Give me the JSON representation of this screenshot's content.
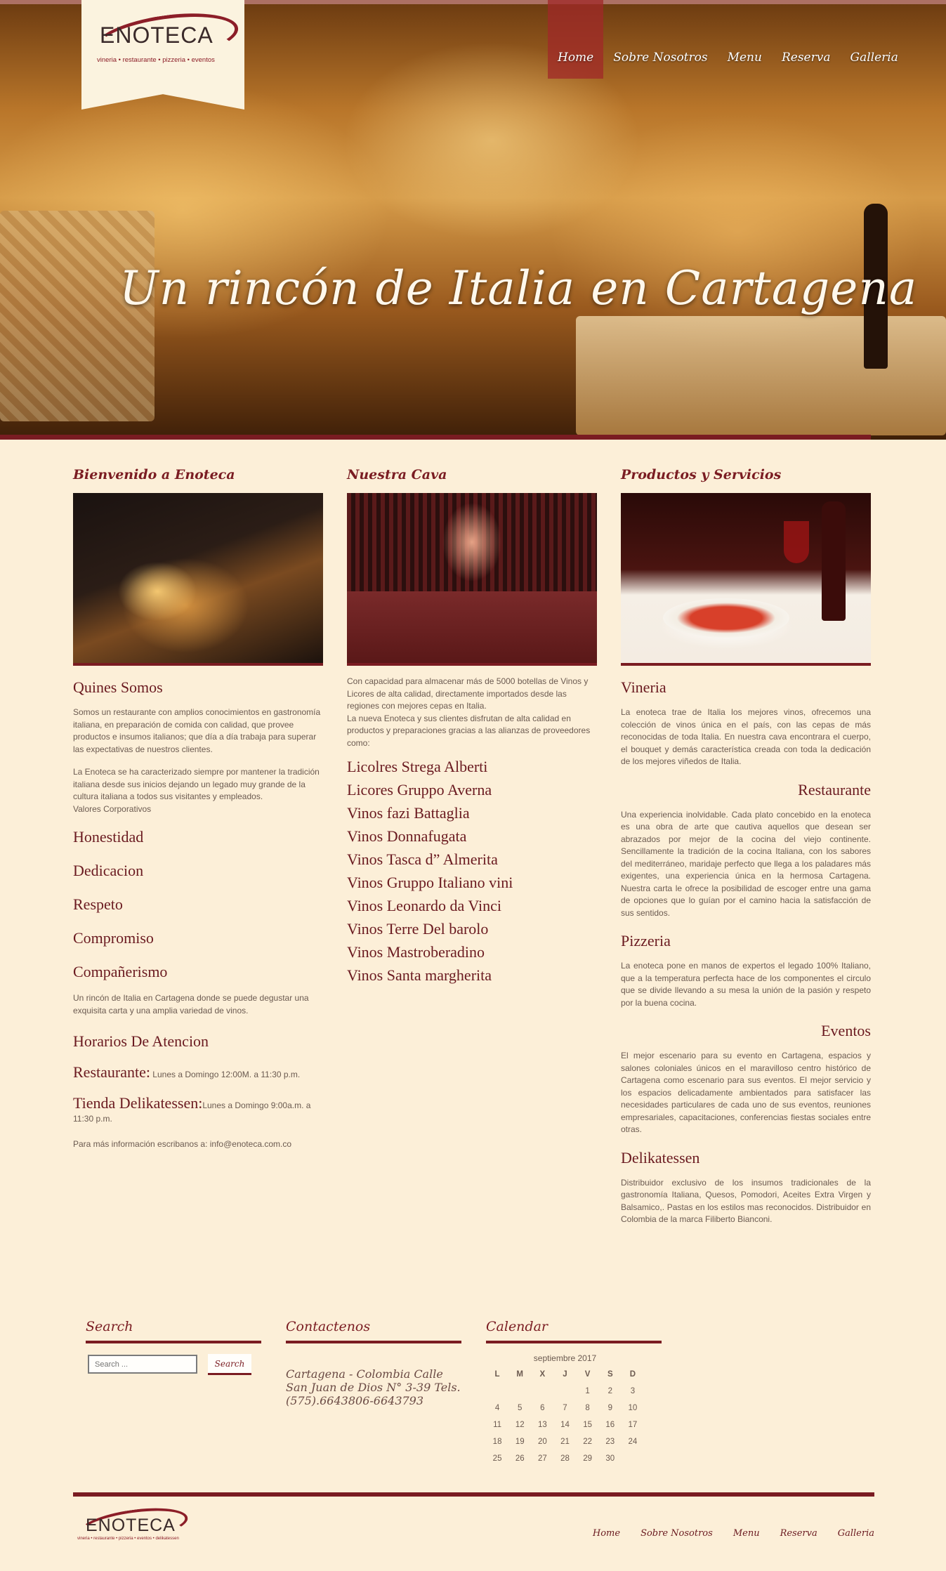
{
  "header": {
    "logo": {
      "name": "ENOTECA",
      "subtitle": "vineria • restaurante • pizzeria • eventos"
    },
    "nav": [
      {
        "label": "Home",
        "active": true
      },
      {
        "label": "Sobre Nosotros"
      },
      {
        "label": "Menu"
      },
      {
        "label": "Reserva"
      },
      {
        "label": "Galleria"
      }
    ],
    "tagline": "Un rincón de Italia en  Cartagena"
  },
  "col1": {
    "title": "Bienvenido a Enoteca",
    "heading": "Quines Somos",
    "para1": "Somos un restaurante con amplios conocimientos en gastronomía italiana, en preparación de comida con calidad, que provee productos e insumos italianos; que día a día trabaja para superar las expectativas de nuestros clientes.",
    "para2": "La Enoteca se ha caracterizado siempre por mantener la tradición italiana desde sus inicios dejando un legado muy grande de la cultura italiana a todos sus visitantes y empleados.",
    "values_label": "Valores Corporativos",
    "values": [
      "Honestidad",
      "Dedicacion",
      "Respeto",
      "Compromiso",
      "Compañerismo"
    ],
    "para3": "Un rincón de Italia en Cartagena donde se puede degustar una exquisita carta y una amplia variedad de vinos.",
    "hours_heading": "Horarios De Atencion",
    "hours": [
      {
        "label": "Restaurante:",
        "text": " Lunes a Domingo 12:00M. a 11:30 p.m."
      },
      {
        "label": "Tienda Delikatessen:",
        "text": "Lunes a Domingo 9:00a.m. a 11:30 p.m."
      }
    ],
    "contact_text": "Para más información escribanos a: info@enoteca.com.co"
  },
  "col2": {
    "title": "Nuestra Cava",
    "para": "Con capacidad para almacenar más de 5000 botellas de Vinos y Licores de alta calidad, directamente importados desde las regiones con mejores cepas en Italia.\nLa nueva Enoteca y sus clientes disfrutan de alta calidad en productos y preparaciones gracias a las alianzas de proveedores como:",
    "wines": [
      "Licolres Strega Alberti",
      "Licores Gruppo Averna",
      "Vinos fazi Battaglia",
      "Vinos Donnafugata",
      "Vinos Tasca d” Almerita",
      "Vinos Gruppo Italiano vini",
      "Vinos Leonardo da Vinci",
      "Vinos Terre Del barolo",
      "Vinos Mastroberadino",
      "Vinos Santa margherita"
    ]
  },
  "col3": {
    "title": "Productos y Servicios",
    "services": [
      {
        "name": "Vineria",
        "align": "left",
        "text": "La enoteca trae de Italia los mejores vinos, ofrecemos una colección de vinos única en el país, con las cepas de más reconocidas de toda Italia. En nuestra cava encontrara el cuerpo, el bouquet y demás característica creada con toda la dedicación de los mejores viñedos de Italia."
      },
      {
        "name": "Restaurante",
        "align": "right",
        "text": "Una experiencia inolvidable. Cada plato concebido en la enoteca es una obra de arte que cautiva aquellos que desean ser abrazados por mejor de la cocina del viejo continente. Sencillamente la tradición de la cocina Italiana, con los sabores del mediterráneo, maridaje perfecto que llega a los paladares más exigentes, una experiencia única en la hermosa Cartagena. Nuestra carta le ofrece la posibilidad de escoger entre una gama de opciones que lo guían por el camino hacia la satisfacción de sus sentidos."
      },
      {
        "name": "Pizzeria",
        "align": "left",
        "text": "La enoteca pone en manos de expertos el legado 100% Italiano, que a la temperatura perfecta hace de los componentes el circulo que se divide llevando a su mesa la unión de la pasión y respeto por la buena cocina."
      },
      {
        "name": "Eventos",
        "align": "right",
        "text": "El mejor escenario para su evento en Cartagena, espacios y salones coloniales únicos en el maravilloso centro histórico de Cartagena como escenario para sus eventos. El mejor servicio y los espacios delicadamente ambientados para satisfacer las necesidades particulares de cada uno de sus eventos, reuniones empresariales, capacitaciones, conferencias fiestas sociales entre otras."
      },
      {
        "name": "Delikatessen",
        "align": "left",
        "text": "Distribuidor exclusivo de los insumos tradicionales de la gastronomía Italiana, Quesos, Pomodori, Aceites Extra Virgen y Balsamico,. Pastas en los estilos mas reconocidos. Distribuidor en Colombia de la marca Filiberto Bianconi."
      }
    ]
  },
  "widgets": {
    "search": {
      "title": "Search",
      "placeholder": "Search ...",
      "button": "Search"
    },
    "contact": {
      "title": "Contactenos",
      "text": "Cartagena - Colombia Calle San Juan de Dios N° 3-39 Tels. (575).6643806-6643793"
    },
    "calendar": {
      "title": "Calendar",
      "caption": "septiembre 2017",
      "days": [
        "L",
        "M",
        "X",
        "J",
        "V",
        "S",
        "D"
      ],
      "weeks": [
        [
          "",
          "",
          "",
          "",
          "1",
          "2",
          "3"
        ],
        [
          "4",
          "5",
          "6",
          "7",
          "8",
          "9",
          "10"
        ],
        [
          "11",
          "12",
          "13",
          "14",
          "15",
          "16",
          "17"
        ],
        [
          "18",
          "19",
          "20",
          "21",
          "22",
          "23",
          "24"
        ],
        [
          "25",
          "26",
          "27",
          "28",
          "29",
          "30",
          ""
        ]
      ]
    }
  },
  "footer": {
    "logo": {
      "name": "ENOTECA",
      "subtitle": "vineria • restaurante • pizzeria • eventos • delikatessen"
    },
    "nav": [
      "Home",
      "Sobre Nosotros",
      "Menu",
      "Reserva",
      "Galleria"
    ]
  },
  "colors": {
    "accent": "#7a1c22",
    "background": "#fcefd8"
  }
}
